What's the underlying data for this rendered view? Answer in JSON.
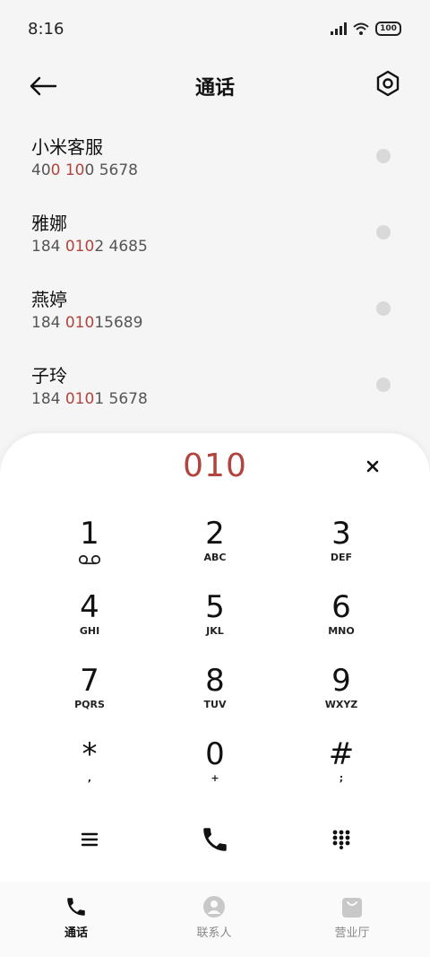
{
  "status_bar": {
    "time": "8:16",
    "battery": "100"
  },
  "header": {
    "title": "通话"
  },
  "contacts": [
    {
      "name": "小米客服",
      "number_parts": [
        "40",
        "0 10",
        "0 5678"
      ]
    },
    {
      "name": "雅娜",
      "number_parts": [
        "184 ",
        "010",
        "2 4685"
      ]
    },
    {
      "name": "燕婷",
      "number_parts": [
        "184 ",
        "010",
        "15689"
      ]
    },
    {
      "name": "子玲",
      "number_parts": [
        "184 ",
        "010",
        "1 5678"
      ]
    }
  ],
  "dialer": {
    "number": "010",
    "keys": [
      {
        "digit": "1",
        "sub": "voicemail"
      },
      {
        "digit": "2",
        "sub": "ABC"
      },
      {
        "digit": "3",
        "sub": "DEF"
      },
      {
        "digit": "4",
        "sub": "GHI"
      },
      {
        "digit": "5",
        "sub": "JKL"
      },
      {
        "digit": "6",
        "sub": "MNO"
      },
      {
        "digit": "7",
        "sub": "PQRS"
      },
      {
        "digit": "8",
        "sub": "TUV"
      },
      {
        "digit": "9",
        "sub": "WXYZ"
      },
      {
        "digit": "*",
        "sub": ","
      },
      {
        "digit": "0",
        "sub": "+"
      },
      {
        "digit": "#",
        "sub": ";"
      }
    ]
  },
  "tabs": [
    {
      "label": "通话",
      "icon": "phone-icon",
      "active": true
    },
    {
      "label": "联系人",
      "icon": "person-icon",
      "active": false
    },
    {
      "label": "营业厅",
      "icon": "shopping-bag-icon",
      "active": false
    }
  ],
  "colors": {
    "accent": "#b0453e",
    "background": "#f5f5f5"
  }
}
